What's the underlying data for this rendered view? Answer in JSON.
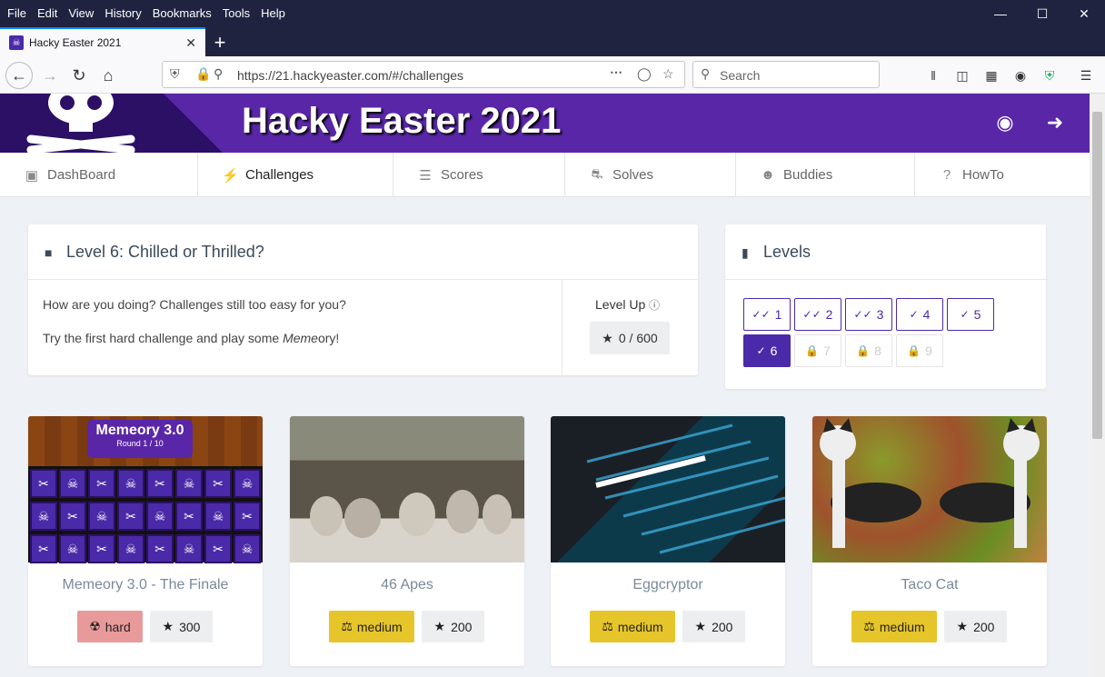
{
  "browser": {
    "menu": [
      "File",
      "Edit",
      "View",
      "History",
      "Bookmarks",
      "Tools",
      "Help"
    ],
    "tab_title": "Hacky Easter 2021",
    "url": "https://21.hackyeaster.com/#/challenges",
    "search_placeholder": "Search"
  },
  "banner": {
    "title": "Hacky Easter 2021"
  },
  "nav": [
    {
      "label": "DashBoard",
      "icon": "dashboard-icon"
    },
    {
      "label": "Challenges",
      "icon": "bolt-icon"
    },
    {
      "label": "Scores",
      "icon": "list-icon"
    },
    {
      "label": "Solves",
      "icon": "trophy-icon"
    },
    {
      "label": "Buddies",
      "icon": "users-icon"
    },
    {
      "label": "HowTo",
      "icon": "question-icon"
    }
  ],
  "level_card": {
    "title": "Level 6: Chilled or Thrilled?",
    "text1": "How are you doing? Challenges still too easy for you?",
    "text2_pre": "Try the first hard challenge and play some ",
    "text2_em": "Meme",
    "text2_post": "ory!",
    "levelup_label": "Level Up",
    "levelup_value": "0 / 600"
  },
  "levels_card": {
    "title": "Levels",
    "levels": [
      {
        "n": "1",
        "state": "done-all"
      },
      {
        "n": "2",
        "state": "done-all"
      },
      {
        "n": "3",
        "state": "done-all"
      },
      {
        "n": "4",
        "state": "done"
      },
      {
        "n": "5",
        "state": "done"
      },
      {
        "n": "6",
        "state": "current"
      },
      {
        "n": "7",
        "state": "locked"
      },
      {
        "n": "8",
        "state": "locked"
      },
      {
        "n": "9",
        "state": "locked"
      }
    ]
  },
  "memeory_img": {
    "title": "Memeory 3.0",
    "round": "Round 1 / 10"
  },
  "challenges": [
    {
      "name": "Memeory 3.0 - The Finale",
      "difficulty": "hard",
      "points": "300"
    },
    {
      "name": "46 Apes",
      "difficulty": "medium",
      "points": "200"
    },
    {
      "name": "Eggcryptor",
      "difficulty": "medium",
      "points": "200"
    },
    {
      "name": "Taco Cat",
      "difficulty": "medium",
      "points": "200"
    }
  ],
  "colors": {
    "brand": "#5a26a8",
    "level_accent": "#4a2aa8",
    "hard": "#e89a9a",
    "medium": "#e6c52a"
  }
}
